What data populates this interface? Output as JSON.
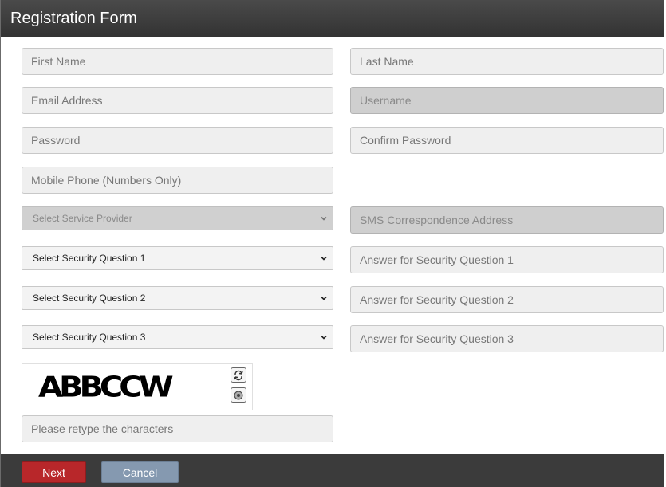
{
  "header": {
    "title": "Registration Form"
  },
  "fields": {
    "first_name": "First Name",
    "last_name": "Last Name",
    "email": "Email Address",
    "username": "Username",
    "password": "Password",
    "confirm_password": "Confirm Password",
    "mobile_phone": "Mobile Phone (Numbers Only)",
    "sms_address": "SMS Correspondence Address",
    "answer1": "Answer for Security Question 1",
    "answer2": "Answer for Security Question 2",
    "answer3": "Answer for Security Question 3",
    "captcha_input": "Please retype the characters"
  },
  "selects": {
    "service_provider": "Select Service Provider",
    "question1": "Select Security Question 1",
    "question2": "Select Security Question 2",
    "question3": "Select Security Question 3"
  },
  "captcha": {
    "text": "ABBCCW"
  },
  "footer": {
    "next_label": "Next",
    "cancel_label": "Cancel"
  },
  "colors": {
    "next": "#b8272a",
    "cancel": "#8599b0",
    "header": "#3b3b3b"
  }
}
